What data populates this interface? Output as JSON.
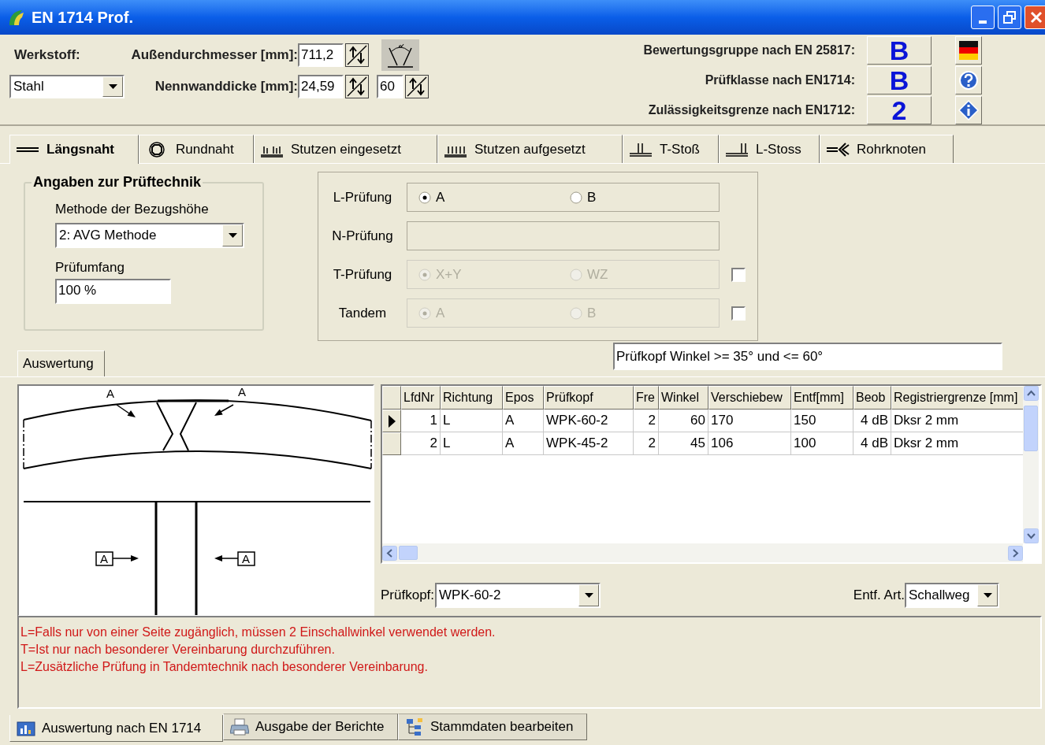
{
  "window": {
    "title": "EN 1714 Prof."
  },
  "header": {
    "material_label": "Werkstoff:",
    "material": "Stahl",
    "diameter_label": "Außendurchmesser [mm]:",
    "diameter": "711,2",
    "wall_label": "Nennwanddicke [mm]:",
    "wall": "24,59",
    "angle": "60",
    "ratings": [
      {
        "label": "Bewertungsgruppe nach EN 25817:",
        "value": "B"
      },
      {
        "label": "Prüfklasse nach EN1714:",
        "value": "B"
      },
      {
        "label": "Zulässigkeitsgrenze nach EN1712:",
        "value": "2"
      }
    ]
  },
  "tabs": [
    {
      "label": "Längsnaht",
      "selected": true
    },
    {
      "label": "Rundnaht",
      "selected": false
    },
    {
      "label": "Stutzen eingesetzt",
      "selected": false
    },
    {
      "label": "Stutzen aufgesetzt",
      "selected": false
    },
    {
      "label": "T-Stoß",
      "selected": false
    },
    {
      "label": "L-Stoss",
      "selected": false
    },
    {
      "label": "Rohrknoten",
      "selected": false
    }
  ],
  "technique": {
    "title": "Angaben zur Prüftechnik",
    "method_label": "Methode der Bezugshöhe",
    "method": "2: AVG Methode",
    "scope_label": "Prüfumfang",
    "scope": "100 %"
  },
  "tests": [
    {
      "label": "L-Prüfung",
      "disabled": false,
      "options": [
        {
          "label": "A",
          "selected": true
        },
        {
          "label": "B",
          "selected": false
        }
      ]
    },
    {
      "label": "N-Prüfung"
    },
    {
      "label": "T-Prüfung",
      "disabled": true,
      "checked": false,
      "options": [
        {
          "label": "X+Y",
          "selected": true
        },
        {
          "label": "WZ",
          "selected": false
        }
      ]
    },
    {
      "label": "Tandem",
      "disabled": true,
      "checked": false,
      "options": [
        {
          "label": "A",
          "selected": true
        },
        {
          "label": "B",
          "selected": false
        }
      ]
    }
  ],
  "evaluation_tab": "Auswertung",
  "hint": "Prüfkopf Winkel >= 35° und <= 60°",
  "drawing": {
    "labels": [
      "A",
      "A",
      "A",
      "A"
    ]
  },
  "table": {
    "columns": [
      "LfdNr",
      "Richtung",
      "Epos",
      "Prüfkopf",
      "Fre",
      "Winkel",
      "Verschiebew",
      "Entf[mm]",
      "Beob",
      "Registriergrenze [mm]"
    ],
    "rows": [
      {
        "selected": true,
        "cells": [
          "1",
          "L",
          "A",
          "WPK-60-2",
          "2",
          "60",
          "170",
          "150",
          "4 dB",
          "Dksr 2 mm"
        ]
      },
      {
        "selected": false,
        "cells": [
          "2",
          "L",
          "A",
          "WPK-45-2",
          "2",
          "45",
          "106",
          "100",
          "4 dB",
          "Dksr 2 mm"
        ]
      }
    ]
  },
  "probe_label": "Prüfkopf:",
  "probe": "WPK-60-2",
  "distance_label": "Entf. Art.",
  "distance": "Schallweg",
  "notes": [
    "L=Falls nur von einer Seite zugänglich, müssen 2 Einschallwinkel verwendet werden.",
    "T=Ist nur nach besonderer Vereinbarung durchzuführen.",
    "L=Zusätzliche Prüfung in Tandemtechnik nach besonderer Vereinbarung."
  ],
  "bottom_tabs": [
    {
      "label": "Auswertung nach EN 1714",
      "selected": true
    },
    {
      "label": "Ausgabe der Berichte",
      "selected": false
    },
    {
      "label": "Stammdaten bearbeiten",
      "selected": false
    }
  ]
}
